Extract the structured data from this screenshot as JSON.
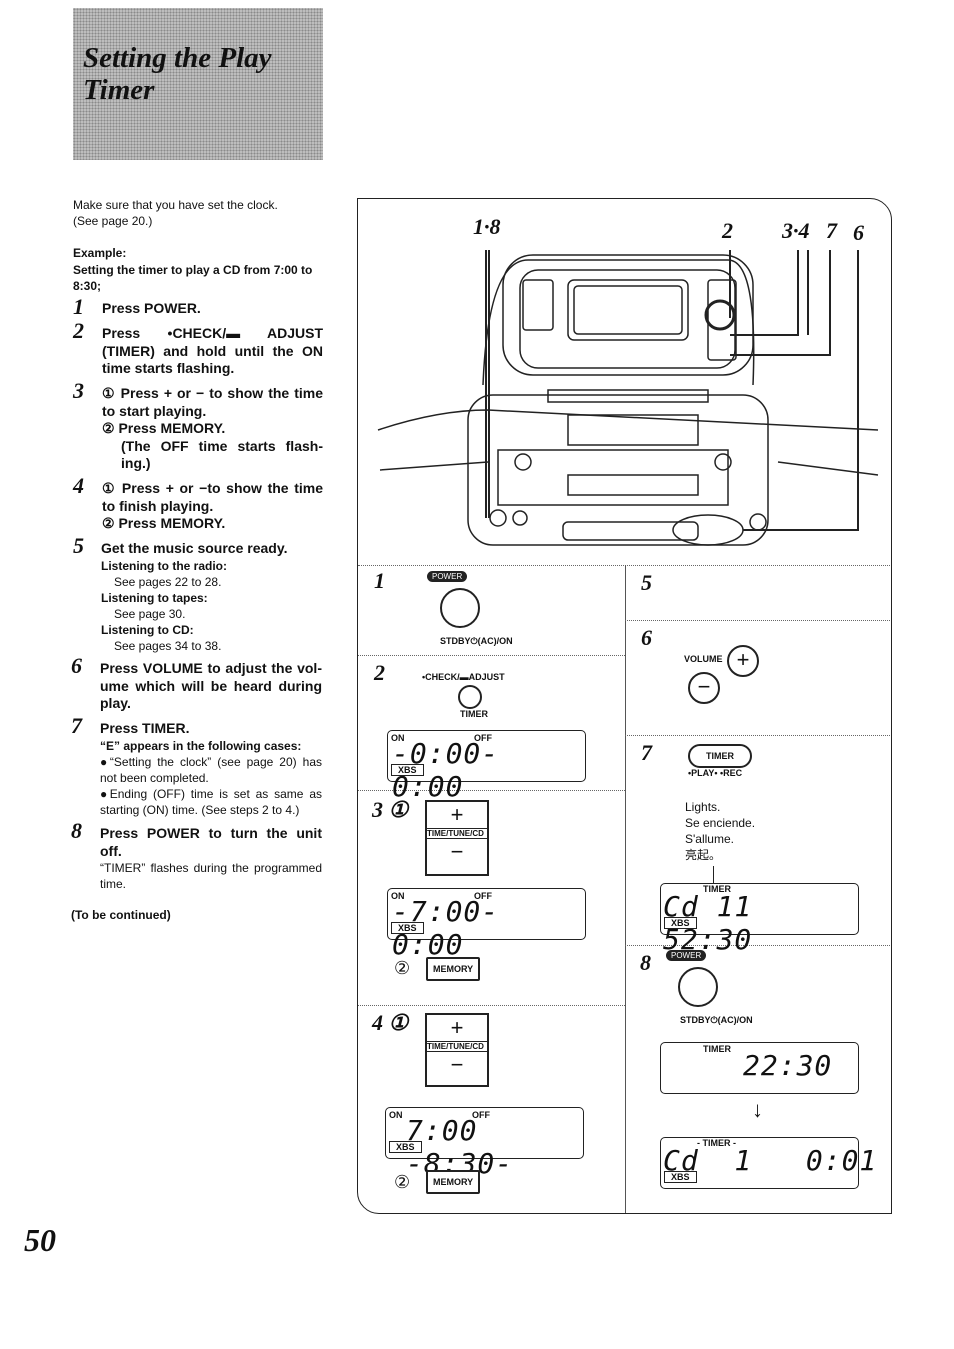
{
  "title": {
    "line1": "Setting the Play",
    "line2": "Timer"
  },
  "intro": {
    "line1": "Make sure that you have set the clock.",
    "line2": "(See page 20.)"
  },
  "example": {
    "label": "Example:",
    "text": "Setting the timer to play a CD from 7:00 to 8:30;"
  },
  "steps": [
    {
      "n": "1",
      "text": "Press POWER."
    },
    {
      "n": "2",
      "text": "Press •CHECK/▬ ADJUST (TIMER) and hold until the ON time starts flashing."
    },
    {
      "n": "3",
      "a": "① Press + or − to show the time to start playing.",
      "b": "② Press MEMORY.",
      "c": "(The OFF time starts flash­ing.)"
    },
    {
      "n": "4",
      "a": "① Press + or −to show the time to finish playing.",
      "b": "② Press MEMORY."
    },
    {
      "n": "5",
      "text": "Get the music source ready.",
      "radio_h": "Listening to the radio:",
      "radio": "See pages 22 to 28.",
      "tape_h": "Listening to tapes:",
      "tape": "See page 30.",
      "cd_h": "Listening to CD:",
      "cd": "See pages 34 to 38."
    },
    {
      "n": "6",
      "text": "Press VOLUME to adjust the vol­ume which will be heard during play."
    },
    {
      "n": "7",
      "text": "Press TIMER.",
      "e_head": "“E” appears in the following cases:",
      "e1": "●“Setting the clock” (see page 20) has not been completed.",
      "e2": "●Ending (OFF) time is set as same as starting (ON) time. (See steps 2 to 4.)"
    },
    {
      "n": "8",
      "text": "Press POWER to turn the unit off.",
      "note": "“TIMER” flashes during the pro­grammed time."
    }
  ],
  "continued": "(To be continued)",
  "page_number": "50",
  "diagram": {
    "callouts": {
      "left": "1·8",
      "c2": "2",
      "c34": "3·4",
      "c7": "7",
      "c6": "6"
    },
    "p1": {
      "n": "1",
      "pill": "POWER",
      "caption": "STDBY⏻(AC)/ON"
    },
    "p2": {
      "n": "2",
      "caption": "•CHECK/▬ADJUST",
      "sub": "TIMER",
      "lcd": {
        "on": "ON",
        "off": "OFF",
        "text": "-0:00- 0:00",
        "xbs": "XBS"
      }
    },
    "p3": {
      "n": "3 ①",
      "plus": "+",
      "minus": "−",
      "key": "TIME/TUNE/CD",
      "lcd": {
        "on": "ON",
        "off": "OFF",
        "text": "-7:00- 0:00",
        "xbs": "XBS"
      },
      "mem_n": "②",
      "memory": "MEMORY"
    },
    "p4": {
      "n": "4 ①",
      "plus": "+",
      "minus": "−",
      "key": "TIME/TUNE/CD",
      "lcd": {
        "on": "ON",
        "off": "OFF",
        "text": "7:00 -8:30-",
        "xbs": "XBS"
      },
      "mem_n": "②",
      "memory": "MEMORY"
    },
    "p5": {
      "n": "5"
    },
    "p6": {
      "n": "6",
      "label": "VOLUME",
      "plus": "+",
      "minus": "−"
    },
    "p7": {
      "n": "7",
      "button": "TIMER",
      "sub": "•PLAY• •REC",
      "lights": [
        "Lights.",
        "Se enciende.",
        "S'allume.",
        "亮起。"
      ],
      "lcd": {
        "timer": "TIMER",
        "text": "Cd 11 52:30",
        "xbs": "XBS"
      }
    },
    "p8": {
      "n": "8",
      "pill": "POWER",
      "caption": "STDBY⏻(AC)/ON",
      "lcd1": {
        "timer": "TIMER",
        "text": "22:30"
      },
      "lcd2": {
        "timer": "- TIMER -",
        "text": "Cd  1   0:01",
        "xbs": "XBS"
      }
    }
  }
}
